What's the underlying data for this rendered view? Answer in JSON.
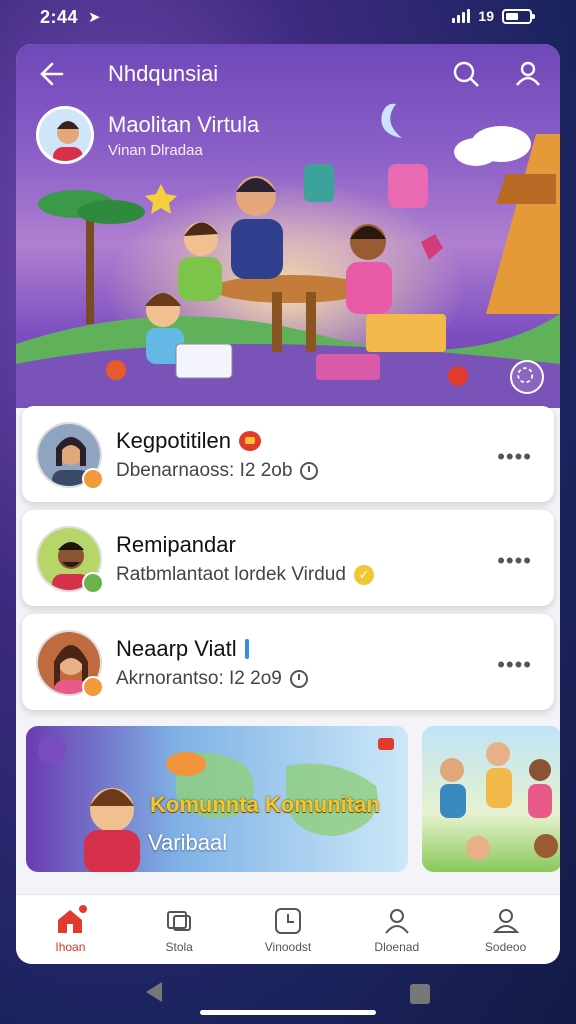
{
  "status_bar": {
    "time": "2:44",
    "network": "19"
  },
  "header": {
    "title": "Nhdqunsiai",
    "profile_name": "Maolitan Virtula",
    "profile_subtitle": "Vinan Dlradaa"
  },
  "list": [
    {
      "title": "Kegpotitilen",
      "subtitle": "Dbenarnaoss: I2 2ob"
    },
    {
      "title": "Remipandar",
      "subtitle": "Ratbmlantaot lordek Virdud"
    },
    {
      "title": "Neaarp Viatl",
      "subtitle": "Akrnorantso: I2 2o9"
    }
  ],
  "banner": {
    "title": "Komunnta Komunitan",
    "subtitle": "Varibaal"
  },
  "tabs": [
    {
      "label": "Ihoan",
      "icon": "home-icon",
      "active": true
    },
    {
      "label": "Stola",
      "icon": "message-icon",
      "active": false
    },
    {
      "label": "Vinoodst",
      "icon": "clock-icon",
      "active": false
    },
    {
      "label": "Dloenad",
      "icon": "person-icon",
      "active": false
    },
    {
      "label": "Sodeoo",
      "icon": "profile-icon",
      "active": false
    }
  ],
  "colors": {
    "accent": "#d9322a",
    "hero": "#7c4ec0",
    "badge_yellow": "#f2c533",
    "badge_green": "#6ab34a"
  }
}
